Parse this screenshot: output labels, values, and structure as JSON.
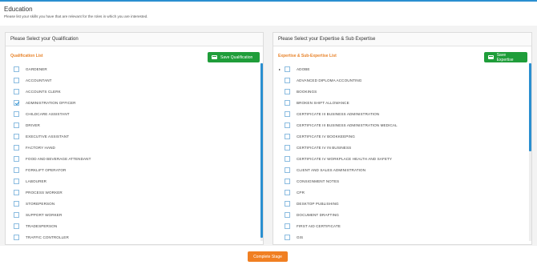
{
  "header": {
    "title": "Education",
    "subtitle": "Please list your skills you have that are relevant for the roles in which you are interested."
  },
  "qualification": {
    "panel_title": "Please Select your Qualification",
    "list_title": "Qualification List",
    "save_label": "Save Qualification",
    "items": [
      {
        "label": "GARDENER",
        "checked": false
      },
      {
        "label": "ACCOUNTANT",
        "checked": false
      },
      {
        "label": "ACCOUNTS CLERK",
        "checked": false
      },
      {
        "label": "ADMINISTRATION OFFICER",
        "checked": true
      },
      {
        "label": "CHILDCARE ASSISTANT",
        "checked": false
      },
      {
        "label": "DRIVER",
        "checked": false
      },
      {
        "label": "EXECUTIVE ASSISTANT",
        "checked": false
      },
      {
        "label": "FACTORY HAND",
        "checked": false
      },
      {
        "label": "FOOD AND BEVERAGE ATTENDANT",
        "checked": false
      },
      {
        "label": "FORKLIFT OPERATOR",
        "checked": false
      },
      {
        "label": "LABOURER",
        "checked": false
      },
      {
        "label": "PROCESS WORKER",
        "checked": false
      },
      {
        "label": "STOREPERSON",
        "checked": false
      },
      {
        "label": "SUPPORT WORKER",
        "checked": false
      },
      {
        "label": "TRADESPERSON",
        "checked": false
      },
      {
        "label": "TRAFFIC CONTROLLER",
        "checked": false
      }
    ]
  },
  "expertise": {
    "panel_title": "Please Select your Expertise & Sub Expertise",
    "list_title": "Expertise & Sub-Expertise List",
    "save_label": "Save Expertise",
    "items": [
      {
        "label": "ADOBE",
        "checked": false
      },
      {
        "label": "ADVANCED DIPLOMA ACCOUNTING",
        "checked": false
      },
      {
        "label": "BOOKINGS",
        "checked": false
      },
      {
        "label": "BROKEN SHIFT ALLOWANCE",
        "checked": false
      },
      {
        "label": "CERTIFICATE III BUSINESS ADMINISTRATION",
        "checked": false
      },
      {
        "label": "CERTIFICATE III BUSINESS ADMINISTRATION MEDICAL",
        "checked": false
      },
      {
        "label": "CERTIFICATE IV BOOKKEEPING",
        "checked": false
      },
      {
        "label": "CERTIFICATE IV IN BUSINESS",
        "checked": false
      },
      {
        "label": "CERTIFICATE IV WORKPLACE HEALTH AND SAFETY",
        "checked": false
      },
      {
        "label": "CLIENT AND SALES ADMINISTRATION",
        "checked": false
      },
      {
        "label": "CONSIGNMENT NOTES",
        "checked": false
      },
      {
        "label": "CPR",
        "checked": false
      },
      {
        "label": "DESKTOP PUBLISHING",
        "checked": false
      },
      {
        "label": "DOCUMENT DRAFTING",
        "checked": false
      },
      {
        "label": "FIRST AID CERTIFICATE",
        "checked": false
      },
      {
        "label": "GIS",
        "checked": false
      }
    ]
  },
  "complete_label": "Complete Stage",
  "colors": {
    "accent": "#2a8fd0",
    "save": "#1f9d3a",
    "complete": "#f07f22",
    "list_title": "#e8832a"
  },
  "icons": {
    "save": "save-icon",
    "expand": "caret-right-icon"
  }
}
